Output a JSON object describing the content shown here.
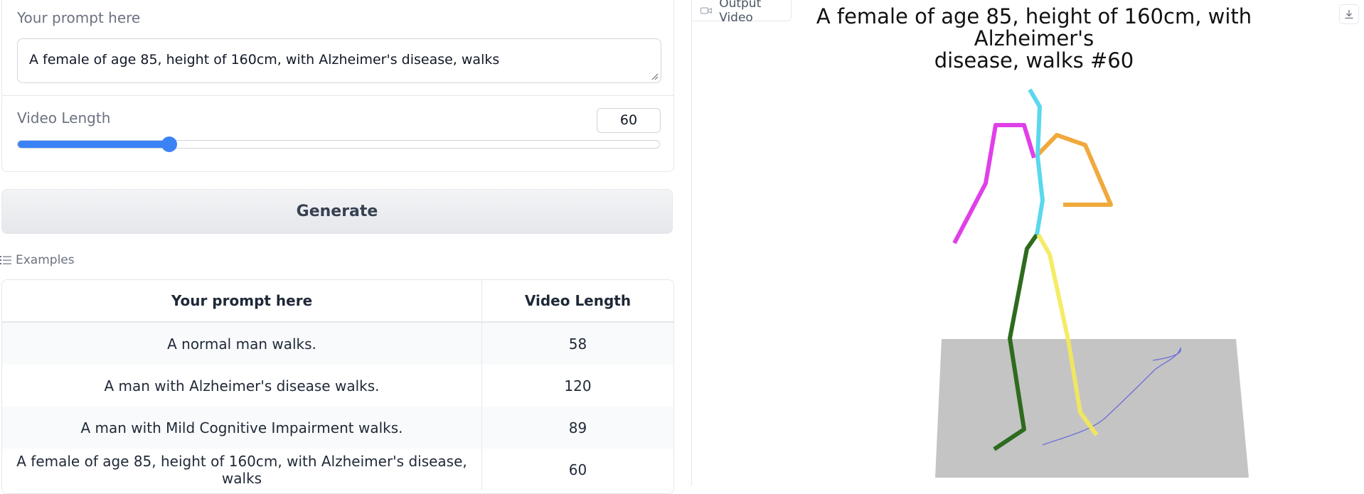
{
  "form": {
    "prompt_label": "Your prompt here",
    "prompt_value": "A female of age 85, height of 160cm, with Alzheimer's disease, walks",
    "length_label": "Video Length",
    "length_value": "60",
    "slider_fraction": 0.236
  },
  "generate_label": "Generate",
  "examples": {
    "label": "Examples",
    "headers": [
      "Your prompt here",
      "Video Length"
    ],
    "rows": [
      [
        "A normal man walks.",
        "58"
      ],
      [
        "A man with Alzheimer's disease walks.",
        "120"
      ],
      [
        "A man with Mild Cognitive Impairment walks.",
        "89"
      ],
      [
        "A female of age 85, height of 160cm, with Alzheimer's disease, walks",
        "60"
      ]
    ]
  },
  "output": {
    "tab_label": "Output Video",
    "title_line1": "A female of age 85, height of 160cm, with Alzheimer's",
    "title_line2": "disease, walks #60"
  },
  "colors": {
    "accent": "#3b82f6",
    "head_spine": "#5ad8ee",
    "right_arm": "#e040e8",
    "left_arm": "#f0a93c",
    "right_leg": "#2e6b1f",
    "left_leg": "#f4ea56",
    "floor": "#c4c4c4",
    "trajectory": "#6d6fd8"
  }
}
